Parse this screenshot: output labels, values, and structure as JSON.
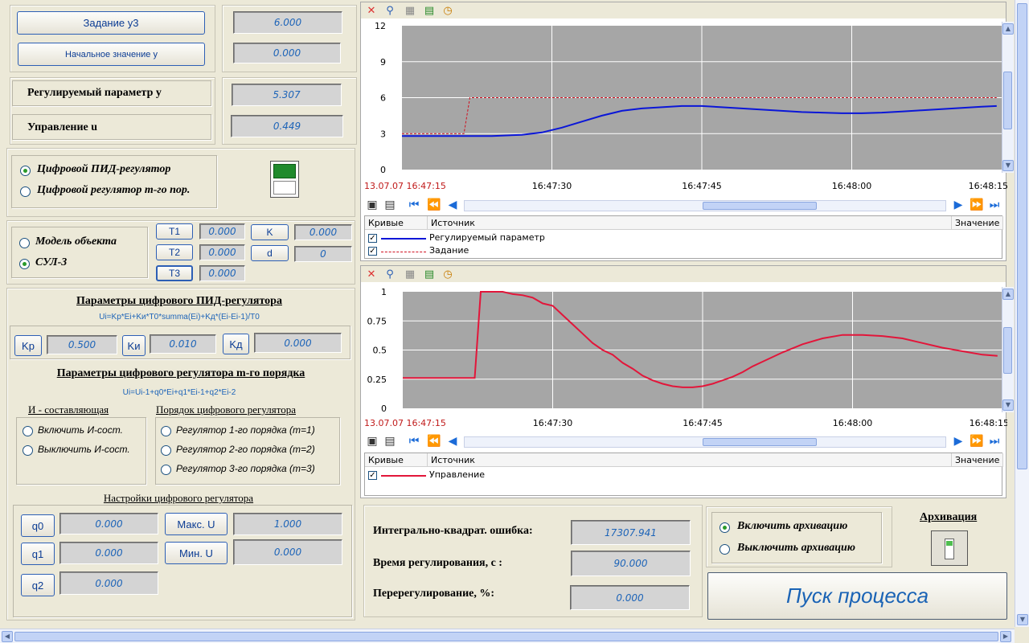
{
  "setpoint": {
    "task_button": "Задание у3",
    "initial_button": "Начальное значение у",
    "task_value": "6.000",
    "initial_value": "0.000"
  },
  "measured": {
    "param_label": "Регулируемый параметр y",
    "param_value": "5.307",
    "control_label": "Управление u",
    "control_value": "0.449"
  },
  "regulator_type": {
    "options": [
      "Цифровой ПИД-регулятор",
      "Цифровой регулятор m-го пор."
    ],
    "selected": 0
  },
  "object": {
    "options": [
      "Модель объекта",
      "СУЛ-3"
    ],
    "selected": 1,
    "t1_label": "T1",
    "t1_value": "0.000",
    "t2_label": "T2",
    "t2_value": "0.000",
    "t3_label": "T3",
    "t3_value": "0.000",
    "k_label": "K",
    "k_value": "0.000",
    "d_label": "d",
    "d_value": "0"
  },
  "pid": {
    "title": "Параметры цифрового ПИД-регулятора",
    "formula": "Ui=Kp*Ei+Kи*T0*summa(Ei)+Kд*(Ei-Ei-1)/T0",
    "kp_label": "Kp",
    "kp_value": "0.500",
    "ki_label": "Kи",
    "ki_value": "0.010",
    "kd_label": "Kд",
    "kd_value": "0.000"
  },
  "mreg": {
    "title": "Параметры цифрового регулятора m-го порядка",
    "formula": "Ui=Ui-1+q0*Ei+q1*Ei-1+q2*Ei-2",
    "i_title": "И - составляющая",
    "i_options": [
      "Включить И-сост.",
      "Выключить И-сост."
    ],
    "order_title": "Порядок цифрового регулятора",
    "order_options": [
      "Регулятор 1-го порядка (m=1)",
      "Регулятор 2-го порядка (m=2)",
      "Регулятор 3-го порядка (m=3)"
    ]
  },
  "settings": {
    "title": "Настройки  цифрового регулятора",
    "q0_label": "q0",
    "q0_value": "0.000",
    "q1_label": "q1",
    "q1_value": "0.000",
    "q2_label": "q2",
    "q2_value": "0.000",
    "umax_label": "Макс. U",
    "umax_value": "1.000",
    "umin_label": "Мин.  U",
    "umin_value": "0.000"
  },
  "results": {
    "ise_label": "Интегрально-квадрат. ошибка:",
    "ise_value": "17307.941",
    "time_label": "Время регулирования, с :",
    "time_value": "90.000",
    "over_label": "Перерегулирование, %:",
    "over_value": "0.000"
  },
  "archive": {
    "title": "Архивация",
    "options": [
      "Включить архивацию",
      "Выключить архивацию"
    ],
    "selected": 0
  },
  "start_button": "Пуск процесса",
  "colors": {
    "plot_bg": "#a6a6a6",
    "series_param": "#0a16d8",
    "series_task": "#d01020",
    "series_control": "#e2163a",
    "value_text": "#1d64b8",
    "start_text": "#1a63b5"
  },
  "legend_headers": {
    "curves": "Кривые",
    "source": "Источник",
    "value": "Значение"
  },
  "chart_data": [
    {
      "type": "line",
      "ylim": [
        0,
        12
      ],
      "yticks": [
        "12",
        "9",
        "6",
        "3",
        "0"
      ],
      "xlim": [
        0,
        60
      ],
      "xticks": [
        {
          "t": 0,
          "label": "13.07.07 16:47:15",
          "start": true
        },
        {
          "t": 15,
          "label": "16:47:30"
        },
        {
          "t": 30,
          "label": "16:47:45"
        },
        {
          "t": 45,
          "label": "16:48:00"
        },
        {
          "t": 60,
          "label": "16:48:15"
        }
      ],
      "series": [
        {
          "name": "Регулируемый параметр",
          "style": "solid",
          "color": "#0a16d8",
          "x": [
            0,
            3,
            6,
            9,
            12,
            14,
            16,
            18,
            20,
            22,
            24,
            26,
            28,
            30,
            32,
            34,
            36,
            38,
            40,
            42,
            44,
            46,
            48,
            50,
            52,
            54,
            56,
            58,
            59.5
          ],
          "y": [
            2.8,
            2.8,
            2.8,
            2.8,
            2.9,
            3.1,
            3.5,
            4.0,
            4.5,
            4.9,
            5.1,
            5.2,
            5.3,
            5.3,
            5.2,
            5.1,
            5.0,
            4.9,
            4.8,
            4.75,
            4.7,
            4.7,
            4.75,
            4.85,
            4.95,
            5.05,
            5.15,
            5.25,
            5.3
          ]
        },
        {
          "name": "Задание",
          "style": "dashed",
          "color": "#d01020",
          "x": [
            0,
            6.2,
            6.8,
            59.5
          ],
          "y": [
            3.0,
            3.0,
            6.0,
            6.0
          ]
        }
      ]
    },
    {
      "type": "line",
      "ylim": [
        0,
        1
      ],
      "yticks": [
        "1",
        "0.75",
        "0.5",
        "0.25",
        "0"
      ],
      "xlim": [
        0,
        60
      ],
      "xticks": [
        {
          "t": 0,
          "label": "13.07.07 16:47:15",
          "start": true
        },
        {
          "t": 15,
          "label": "16:47:30"
        },
        {
          "t": 30,
          "label": "16:47:45"
        },
        {
          "t": 45,
          "label": "16:48:00"
        },
        {
          "t": 60,
          "label": "16:48:15"
        }
      ],
      "series": [
        {
          "name": "Управление",
          "style": "solid",
          "color": "#e2163a",
          "x": [
            0,
            3,
            6,
            7.2,
            7.8,
            8.5,
            10,
            11,
            12,
            13,
            14,
            15,
            16,
            17,
            18,
            19,
            20,
            21,
            22,
            23,
            24,
            25,
            26,
            27,
            28,
            29,
            30,
            31,
            32,
            33,
            34,
            35,
            36,
            38,
            40,
            42,
            44,
            46,
            48,
            50,
            52,
            54,
            56,
            58,
            59.5
          ],
          "y": [
            0.26,
            0.26,
            0.26,
            0.26,
            1.0,
            1.0,
            1.0,
            0.98,
            0.97,
            0.95,
            0.9,
            0.88,
            0.8,
            0.72,
            0.64,
            0.56,
            0.5,
            0.46,
            0.39,
            0.34,
            0.28,
            0.24,
            0.21,
            0.19,
            0.18,
            0.18,
            0.19,
            0.21,
            0.24,
            0.27,
            0.31,
            0.36,
            0.4,
            0.48,
            0.55,
            0.6,
            0.63,
            0.63,
            0.62,
            0.6,
            0.56,
            0.52,
            0.49,
            0.46,
            0.45
          ]
        }
      ]
    }
  ]
}
